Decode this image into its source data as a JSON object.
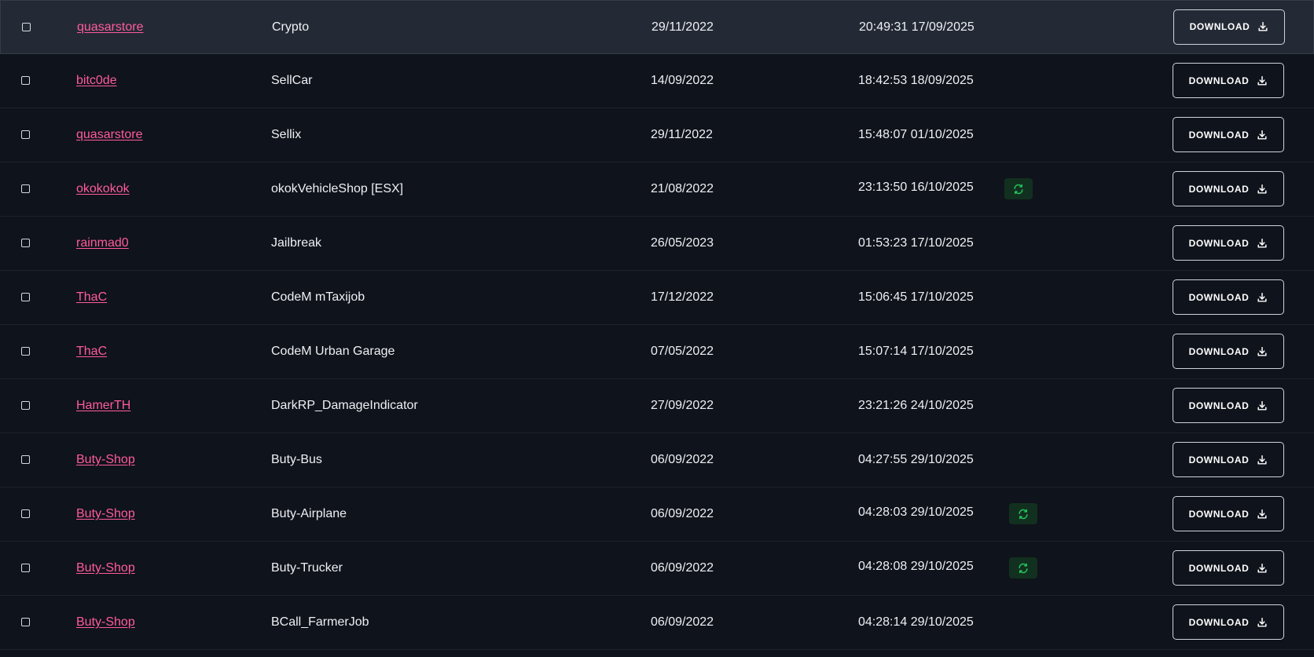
{
  "download_label": "DOWNLOAD",
  "colors": {
    "background": "#0f131b",
    "row_highlight": "#242a35",
    "seller_link": "#ff5b9d",
    "refresh_badge_bg": "#12301f",
    "refresh_icon": "#22c55e"
  },
  "rows": [
    {
      "seller": "quasarstore",
      "product": "Crypto",
      "created": "29/11/2022",
      "updated": "20:49:31 17/09/2025",
      "refresh": false,
      "highlight": true
    },
    {
      "seller": "bitc0de",
      "product": "SellCar",
      "created": "14/09/2022",
      "updated": "18:42:53 18/09/2025",
      "refresh": false,
      "highlight": false
    },
    {
      "seller": "quasarstore",
      "product": "Sellix",
      "created": "29/11/2022",
      "updated": "15:48:07 01/10/2025",
      "refresh": false,
      "highlight": false
    },
    {
      "seller": "okokokok",
      "product": "okokVehicleShop [ESX]",
      "created": "21/08/2022",
      "updated": "23:13:50 16/10/2025",
      "refresh": true,
      "highlight": false
    },
    {
      "seller": "rainmad0",
      "product": "Jailbreak",
      "created": "26/05/2023",
      "updated": "01:53:23 17/10/2025",
      "refresh": false,
      "highlight": false
    },
    {
      "seller": "ThaC",
      "product": "CodeM mTaxijob",
      "created": "17/12/2022",
      "updated": "15:06:45 17/10/2025",
      "refresh": false,
      "highlight": false
    },
    {
      "seller": "ThaC",
      "product": "CodeM Urban Garage",
      "created": "07/05/2022",
      "updated": "15:07:14 17/10/2025",
      "refresh": false,
      "highlight": false
    },
    {
      "seller": "HamerTH",
      "product": "DarkRP_DamageIndicator",
      "created": "27/09/2022",
      "updated": "23:21:26 24/10/2025",
      "refresh": false,
      "highlight": false
    },
    {
      "seller": "Buty-Shop",
      "product": "Buty-Bus",
      "created": "06/09/2022",
      "updated": "04:27:55 29/10/2025",
      "refresh": false,
      "highlight": false
    },
    {
      "seller": "Buty-Shop",
      "product": "Buty-Airplane",
      "created": "06/09/2022",
      "updated": "04:28:03 29/10/2025",
      "refresh": true,
      "highlight": false
    },
    {
      "seller": "Buty-Shop",
      "product": "Buty-Trucker",
      "created": "06/09/2022",
      "updated": "04:28:08 29/10/2025",
      "refresh": true,
      "highlight": false
    },
    {
      "seller": "Buty-Shop",
      "product": "BCall_FarmerJob",
      "created": "06/09/2022",
      "updated": "04:28:14 29/10/2025",
      "refresh": false,
      "highlight": false
    }
  ]
}
